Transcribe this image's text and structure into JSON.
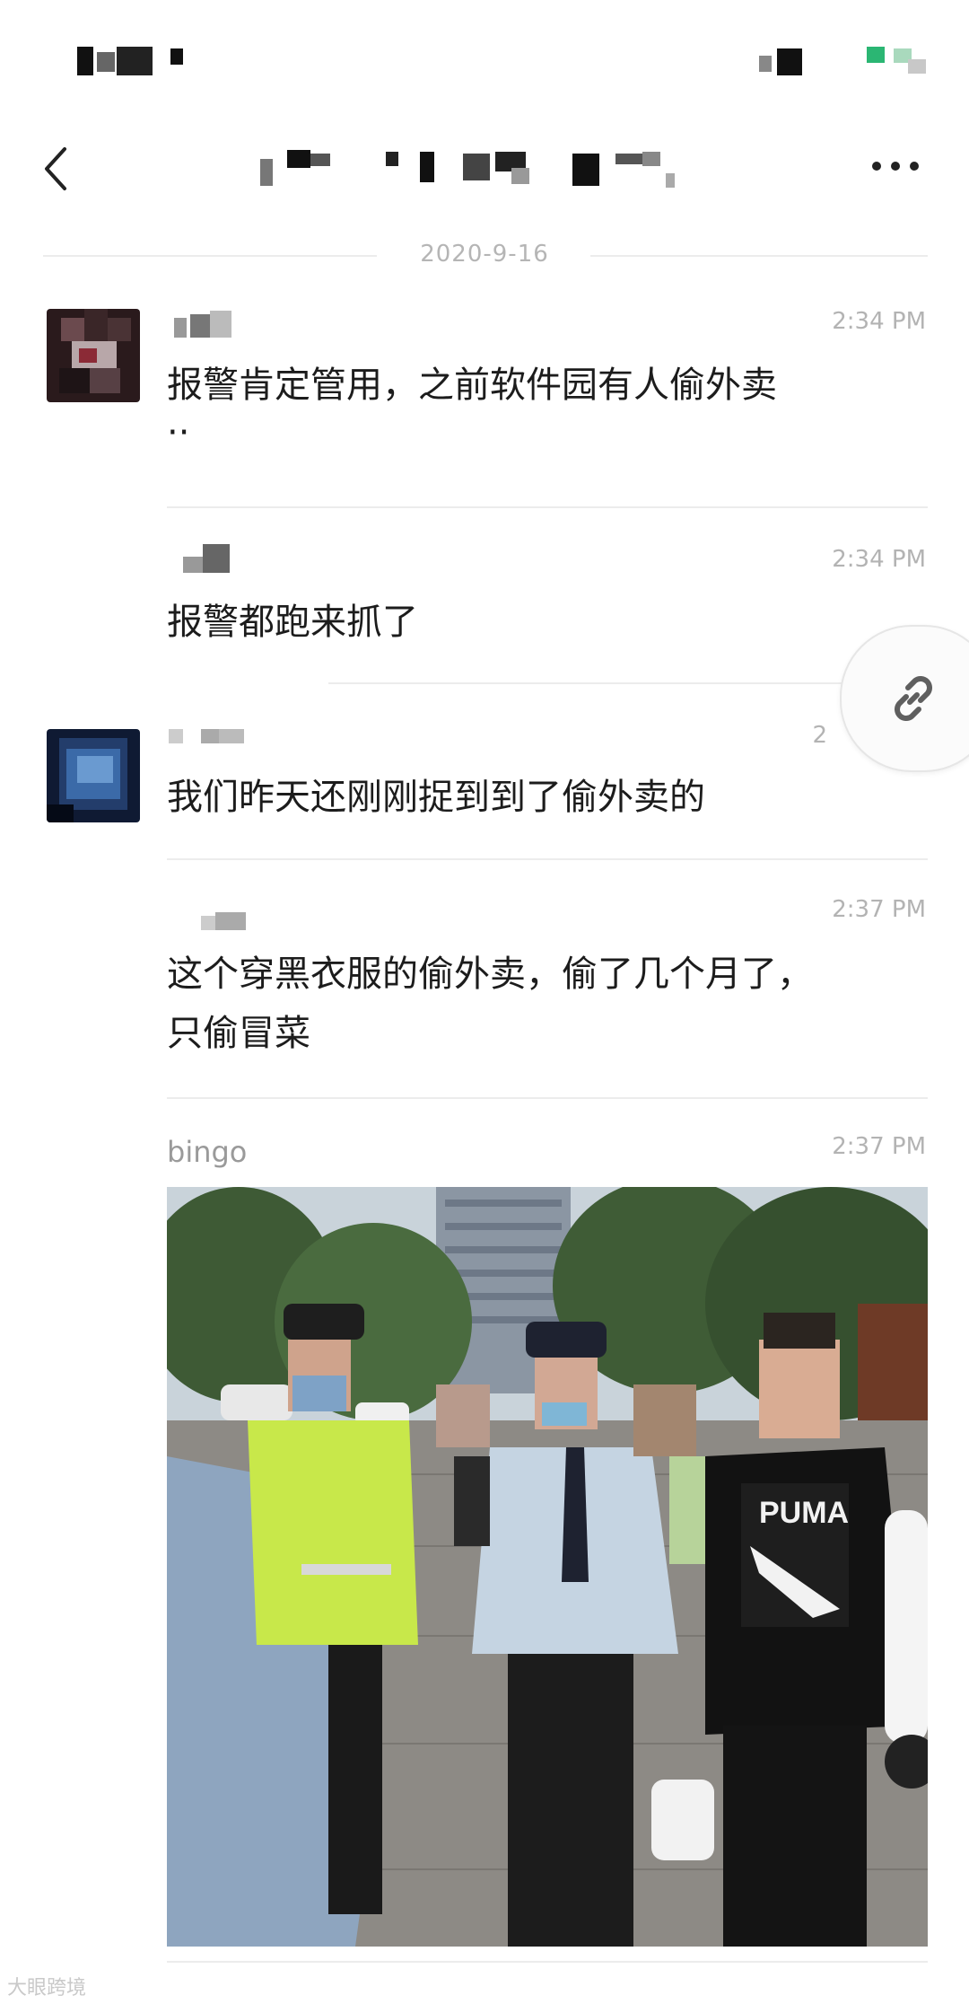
{
  "chat": {
    "date_separator": "2020-9-16"
  },
  "messages": [
    {
      "sender": "",
      "time": "2:34 PM",
      "text": "报警肯定管用，之前软件园有人偷外卖",
      "text2": "··"
    },
    {
      "sender": "",
      "time": "2:34 PM",
      "text": "报警都跑来抓了"
    },
    {
      "sender": "",
      "time": "2",
      "text": "我们昨天还刚刚捉到到了偷外卖的"
    },
    {
      "sender": "",
      "time": "2:37 PM",
      "text": "这个穿黑衣服的偷外卖，偷了几个月了，",
      "text2": "只偷冒菜"
    },
    {
      "sender": "bingo",
      "time": "2:37 PM",
      "photo_caption": ""
    }
  ],
  "photo": {
    "shirt_text": "PUMA"
  },
  "watermark": "大眼跨境"
}
